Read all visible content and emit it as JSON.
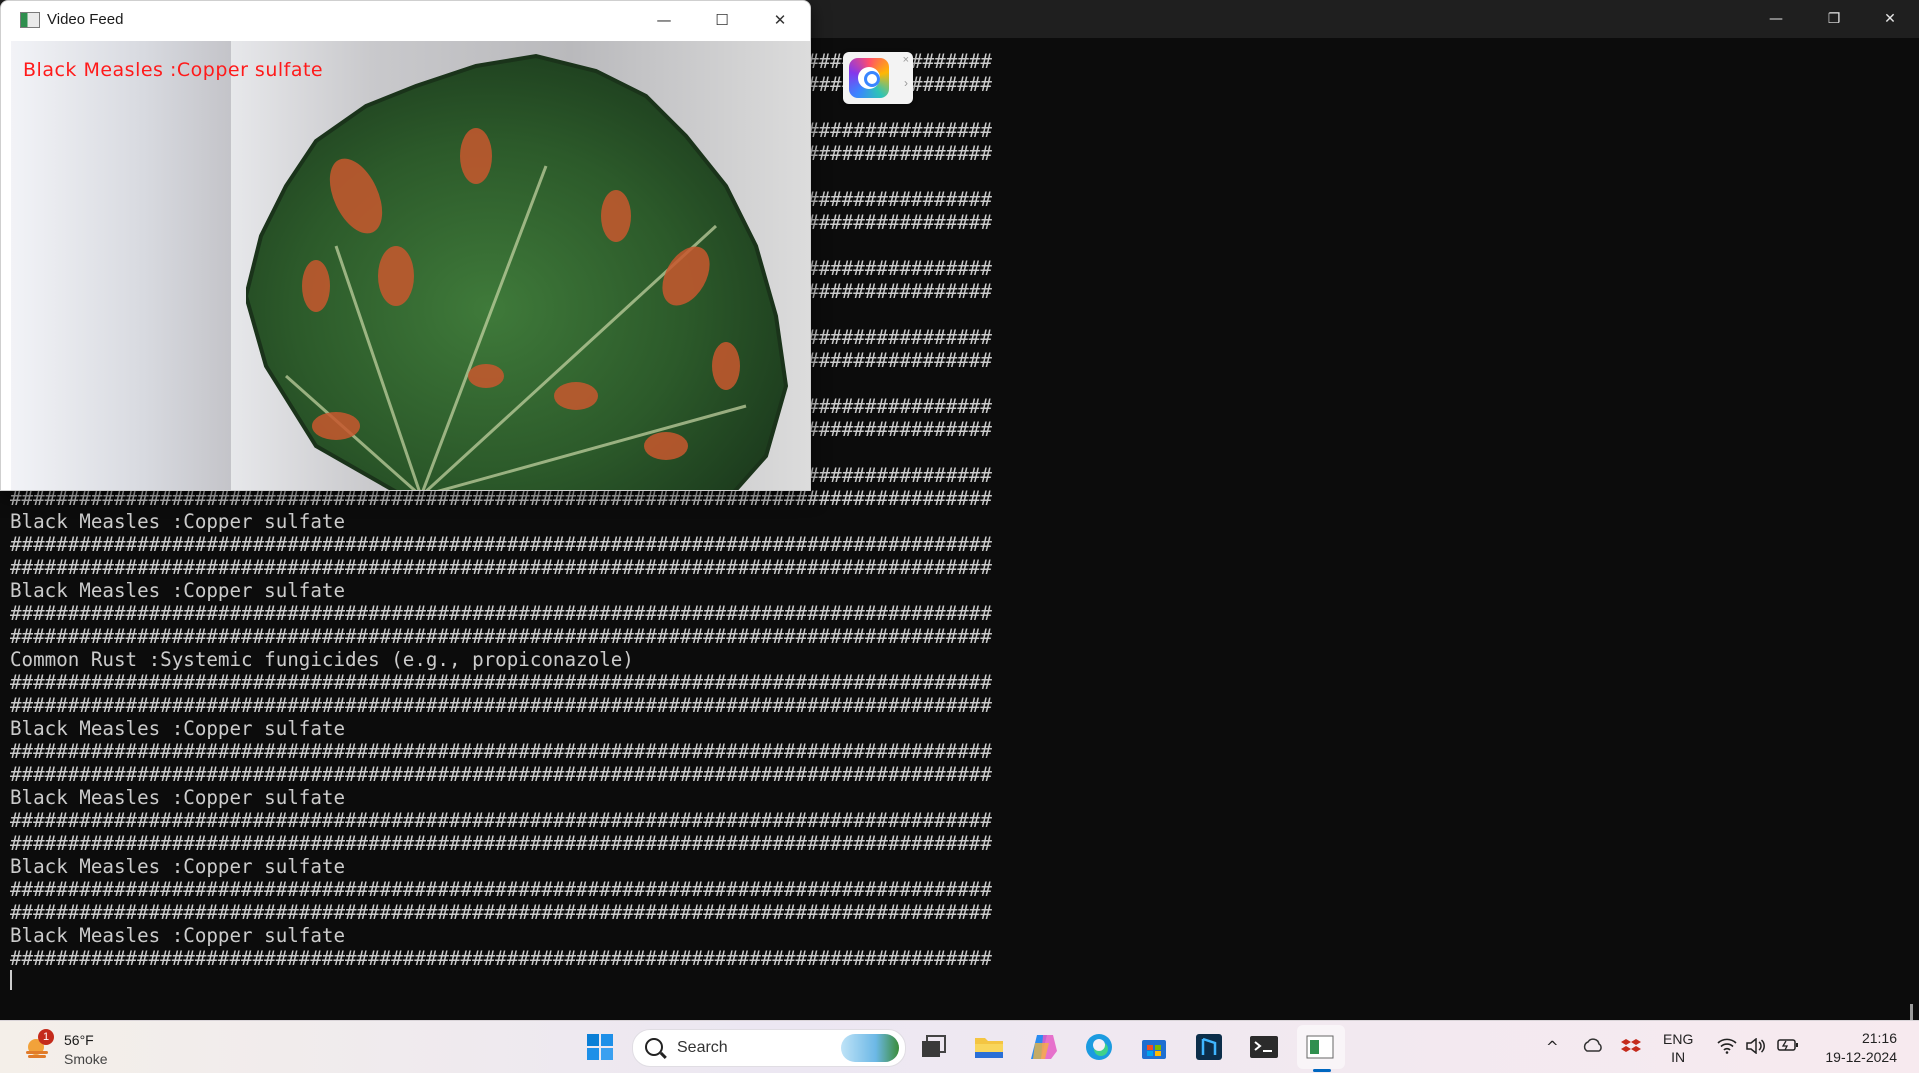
{
  "terminal": {
    "controls": {
      "minimize": "—",
      "restore": "❐",
      "close": "✕"
    },
    "lines": [
      "#####################################################################################",
      "#####################################################################################",
      "",
      "#####################################################################################",
      "#####################################################################################",
      "",
      "#####################################################################################",
      "#####################################################################################",
      "",
      "#####################################################################################",
      "#####################################################################################",
      "",
      "#####################################################################################",
      "#####################################################################################",
      "",
      "#####################################################################################",
      "#####################################################################################",
      "",
      "#####################################################################################",
      "#####################################################################################",
      "Black Measles :Copper sulfate",
      "#####################################################################################",
      "#####################################################################################",
      "Black Measles :Copper sulfate",
      "#####################################################################################",
      "#####################################################################################",
      "Common Rust :Systemic fungicides (e.g., propiconazole)",
      "#####################################################################################",
      "#####################################################################################",
      "Black Measles :Copper sulfate",
      "#####################################################################################",
      "#####################################################################################",
      "Black Measles :Copper sulfate",
      "#####################################################################################",
      "#####################################################################################",
      "Black Measles :Copper sulfate",
      "#####################################################################################",
      "#####################################################################################",
      "Black Measles :Copper sulfate",
      "#####################################################################################"
    ]
  },
  "video_window": {
    "title": "Video Feed",
    "controls": {
      "minimize": "—",
      "maximize": "☐",
      "close": "✕"
    },
    "overlay_text": "Black Measles :Copper sulfate",
    "overlay_color": "#ff1a1a"
  },
  "floating_badge": {
    "close": "×",
    "arrow": "›"
  },
  "taskbar": {
    "weather": {
      "badge": "1",
      "temp": "56°F",
      "condition": "Smoke"
    },
    "search": {
      "label": "Search"
    },
    "tray": {
      "chevron": "^",
      "language": "ENG",
      "region": "IN"
    },
    "clock": {
      "time": "21:16",
      "date": "19-12-2024"
    }
  }
}
